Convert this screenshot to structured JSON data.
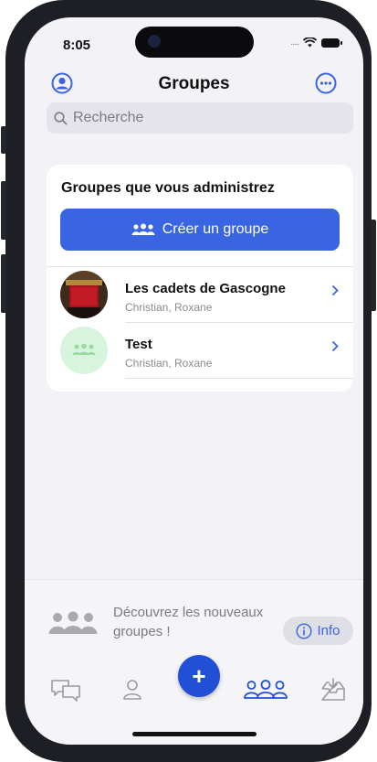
{
  "status": {
    "time": "8:05",
    "dots": "....."
  },
  "header": {
    "title": "Groupes"
  },
  "search": {
    "placeholder": "Recherche"
  },
  "admin_section": {
    "title": "Groupes que vous administrez",
    "create_label": "Créer un groupe",
    "groups": [
      {
        "name": "Les cadets de Gascogne",
        "members": "Christian, Roxane"
      },
      {
        "name": "Test",
        "members": "Christian, Roxane"
      }
    ]
  },
  "discover": {
    "text": "Découvrez les nouveaux groupes !",
    "info_label": "Info"
  },
  "tabbar": {
    "fab_label": "+"
  },
  "colors": {
    "accent": "#3a65e2",
    "fab": "#2150d6",
    "avatar_green": "#d7f5dc"
  }
}
